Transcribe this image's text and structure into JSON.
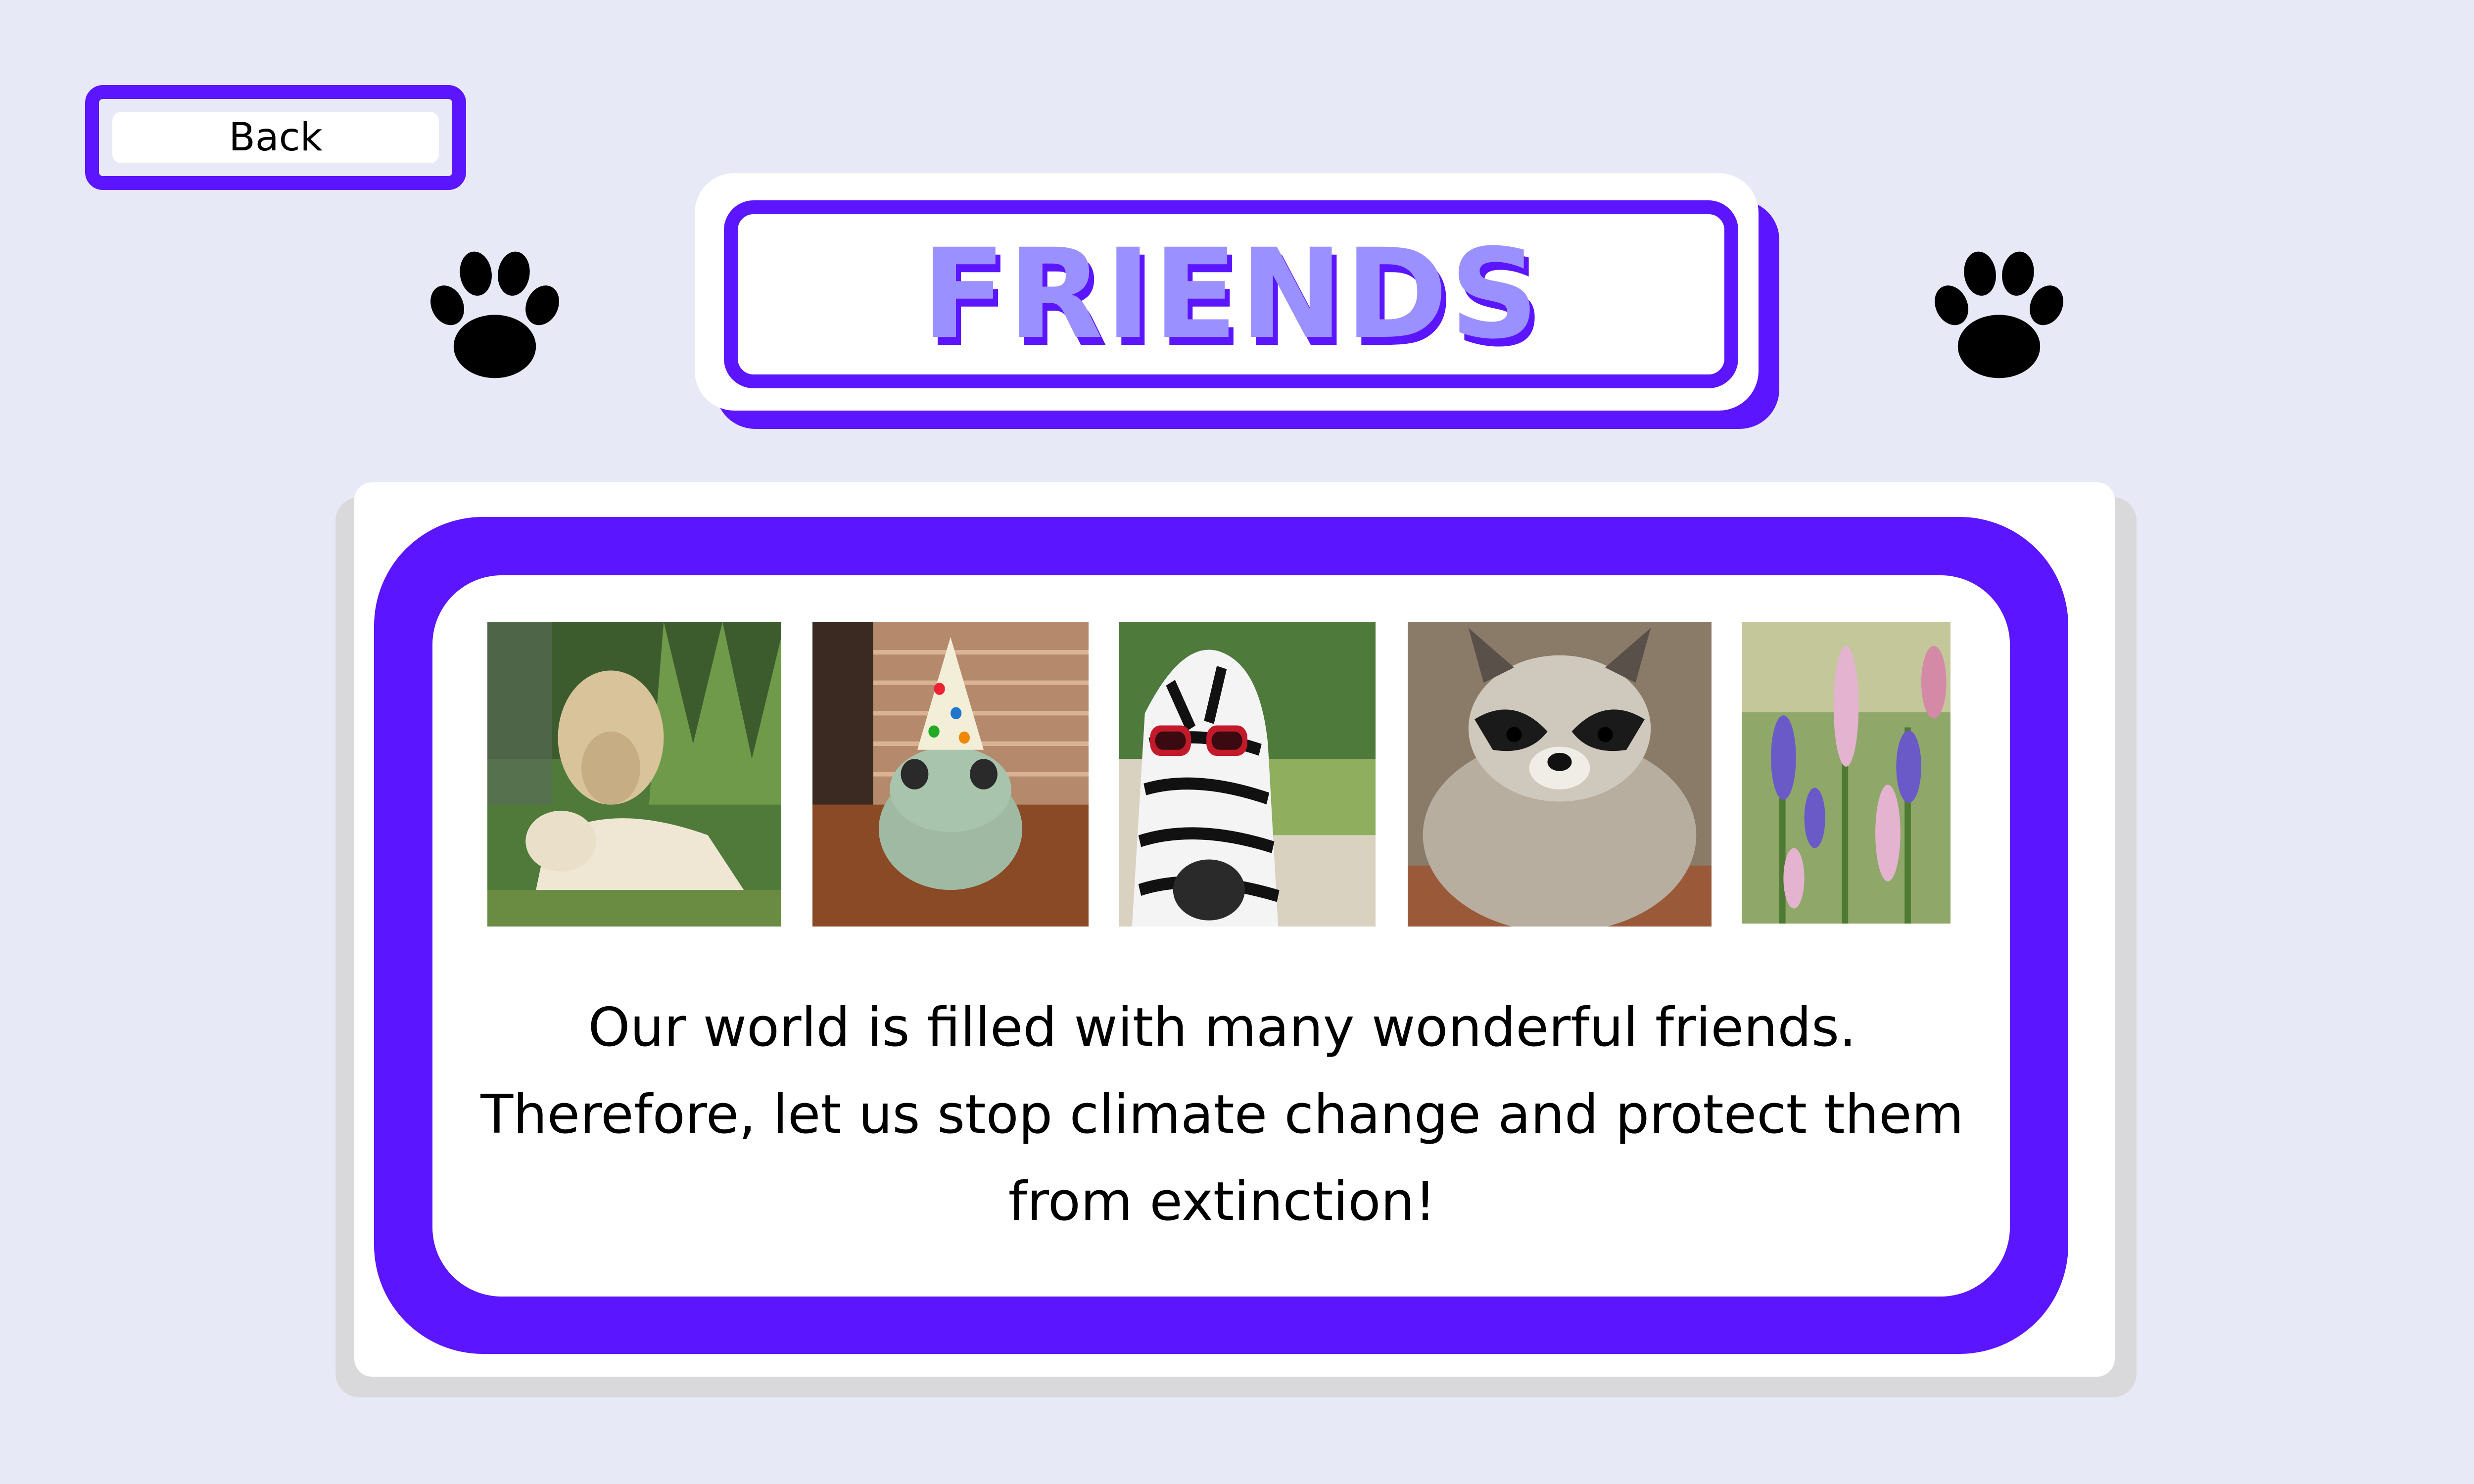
{
  "nav": {
    "back_label": "Back"
  },
  "header": {
    "title": "FRIENDS"
  },
  "gallery": {
    "photos": [
      {
        "subject": "white lion and lioness"
      },
      {
        "subject": "frog wearing party hat"
      },
      {
        "subject": "zebra wearing sunglasses"
      },
      {
        "subject": "raccoon"
      },
      {
        "subject": "lupine flowers"
      }
    ]
  },
  "message": {
    "line1": "Our world is filled with many wonderful friends.",
    "line2": "Therefore, let us stop climate change and protect them",
    "line3": "from extinction!"
  },
  "colors": {
    "background": "#e8e9f6",
    "accent": "#5b16ff",
    "title_fill": "#9b90ff",
    "panel": "#ffffff"
  },
  "icons": {
    "decoration": "paw-print-icon"
  }
}
